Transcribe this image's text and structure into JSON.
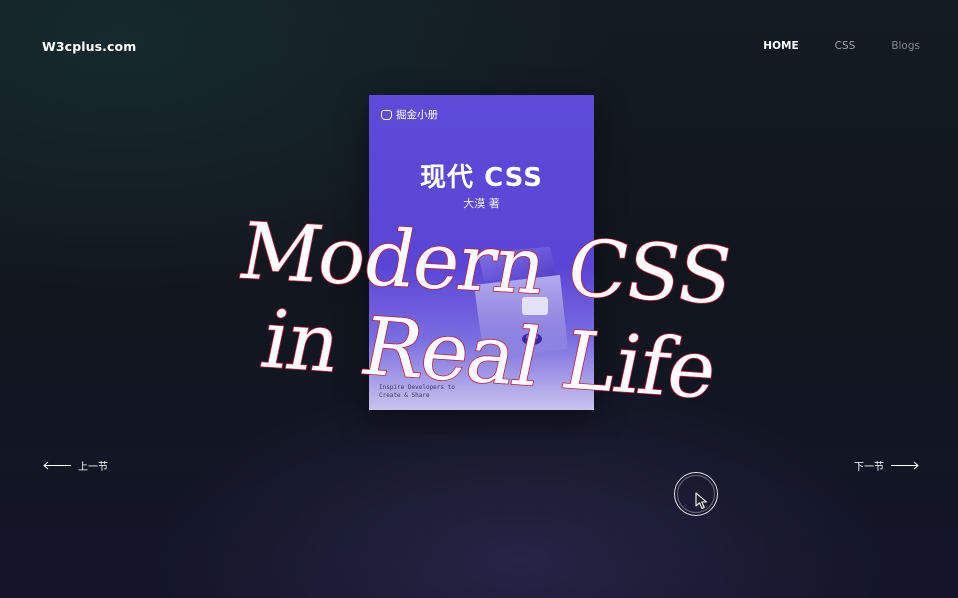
{
  "header": {
    "brand": "W3cplus.com",
    "nav": [
      {
        "label": "HOME",
        "active": true
      },
      {
        "label": "CSS",
        "active": false
      },
      {
        "label": "Blogs",
        "active": false
      }
    ]
  },
  "book": {
    "publisher": "掘金小册",
    "title": "现代 CSS",
    "author": "大漠 著",
    "footer_line1": "Inspire Developers to",
    "footer_line2": "Create & Share",
    "cover_color": "#5a46d6"
  },
  "headline": {
    "line1": "Modern CSS",
    "line2": "in Real Life",
    "fill_color": "#ffffff",
    "stroke_color": "#c2203a"
  },
  "pager": {
    "prev_label": "上一节",
    "next_label": "下一节"
  },
  "cursor": {
    "icon": "pointer-cursor-icon"
  }
}
